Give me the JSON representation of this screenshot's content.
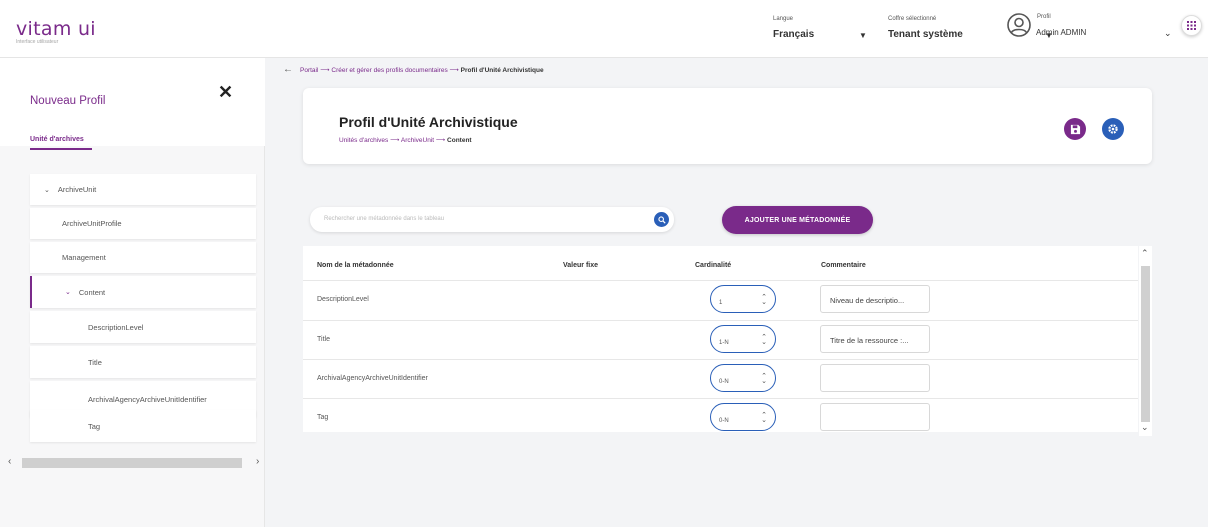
{
  "header": {
    "logo": "vitam ui",
    "logo_sub": "Interface utilisateur",
    "language_label": "Langue",
    "language_value": "Français",
    "tenant_label": "Coffre sélectionné",
    "tenant_value": "Tenant système",
    "profile_label": "Profil",
    "profile_value": "Admin ADMIN"
  },
  "side_panel": {
    "title": "Nouveau Profil",
    "tab": "Unité d'archives",
    "tree": [
      {
        "label": "ArchiveUnit",
        "expanded": true,
        "level": 0
      },
      {
        "label": "ArchiveUnitProfile",
        "level": 1
      },
      {
        "label": "Management",
        "level": 1
      },
      {
        "label": "Content",
        "expanded": true,
        "level": 1,
        "selected": true
      },
      {
        "label": "DescriptionLevel",
        "level": 2
      },
      {
        "label": "Title",
        "level": 2
      },
      {
        "label": "ArchivalAgencyArchiveUnitIdentifier",
        "level": 2
      },
      {
        "label": "Tag",
        "level": 2
      }
    ]
  },
  "breadcrumb": {
    "items": [
      "Portail",
      "Créer et gérer des profils documentaires"
    ],
    "current": "Profil d'Unité Archivistique"
  },
  "card": {
    "title": "Profil d'Unité Archivistique",
    "crumbs": [
      "Unités d'archives",
      "ArchiveUnit"
    ],
    "crumb_current": "Content"
  },
  "search": {
    "placeholder": "Rechercher une métadonnée dans le tableau"
  },
  "add_button": "AJOUTER UNE MÉTADONNÉE",
  "table": {
    "headers": [
      "Nom de la métadonnée",
      "Valeur fixe",
      "Cardinalité",
      "Commentaire"
    ],
    "rows": [
      {
        "name": "DescriptionLevel",
        "cardinality": "1",
        "comment": "Niveau de descriptio..."
      },
      {
        "name": "Title",
        "cardinality": "1-N",
        "comment": "Titre de la ressource :..."
      },
      {
        "name": "ArchivalAgencyArchiveUnitIdentifier",
        "cardinality": "0-N",
        "comment": ""
      },
      {
        "name": "Tag",
        "cardinality": "0-N",
        "comment": ""
      }
    ]
  },
  "colors": {
    "accent": "#7a2a8a",
    "blue": "#2a5fb8"
  }
}
